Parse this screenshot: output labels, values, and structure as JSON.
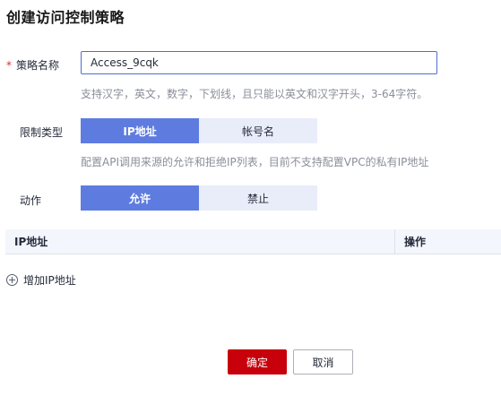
{
  "page": {
    "title": "创建访问控制策略"
  },
  "form": {
    "name": {
      "required_mark": "*",
      "label": "策略名称",
      "value": "Access_9cqk",
      "hint": "支持汉字，英文，数字，下划线，且只能以英文和汉字开头，3-64字符。"
    },
    "restrict_type": {
      "label": "限制类型",
      "options": [
        {
          "label": "IP地址",
          "selected": true
        },
        {
          "label": "帐号名",
          "selected": false
        }
      ],
      "hint": "配置API调用来源的允许和拒绝IP列表，目前不支持配置VPC的私有IP地址"
    },
    "action": {
      "label": "动作",
      "options": [
        {
          "label": "允许",
          "selected": true
        },
        {
          "label": "禁止",
          "selected": false
        }
      ]
    }
  },
  "table": {
    "columns": [
      "IP地址",
      "操作"
    ]
  },
  "add_ip": {
    "icon": "plus-circle-icon",
    "label": "增加IP地址"
  },
  "footer": {
    "confirm_label": "确定",
    "cancel_label": "取消"
  },
  "colors": {
    "primary_red": "#c7000b",
    "segment_active": "#5e7ce0",
    "segment_inactive": "#e9edfa",
    "required": "#e6282b",
    "hint_text": "#8a8e99"
  }
}
